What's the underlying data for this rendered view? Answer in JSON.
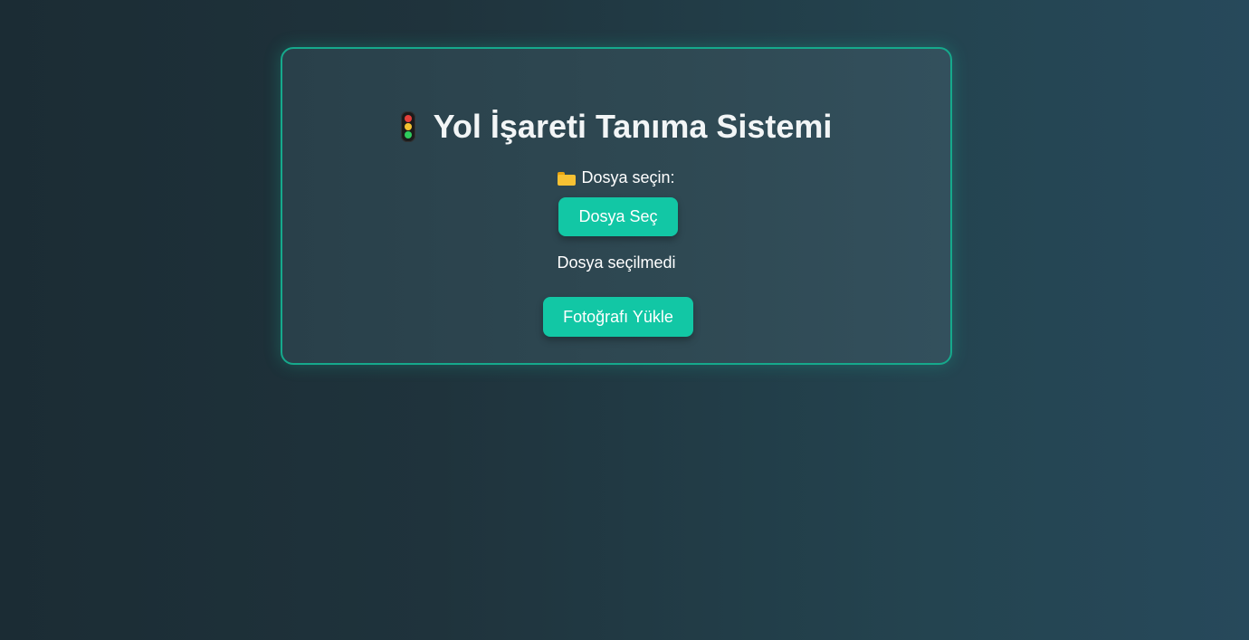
{
  "card": {
    "title": "Yol İşareti Tanıma Sistemi",
    "title_icon": "traffic-light-icon",
    "file_label": "Dosya seçin:",
    "file_label_icon": "folder-icon",
    "choose_button": "Dosya Seç",
    "file_status": "Dosya seçilmedi",
    "upload_button": "Fotoğrafı Yükle"
  },
  "colors": {
    "accent": "#12c7a5",
    "border": "#16a98c",
    "background_dark": "#1b2c34",
    "background_light": "#27495b"
  }
}
